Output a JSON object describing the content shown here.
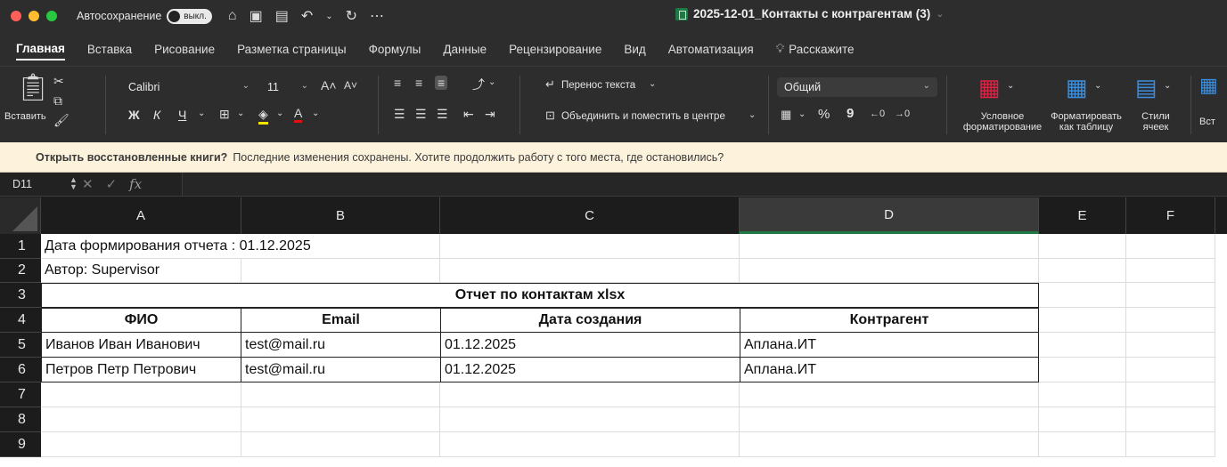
{
  "titlebar": {
    "autosave_label": "Автосохранение",
    "autosave_state": "выкл.",
    "document_title": "2025-12-01_Контакты с контрагентам (3)",
    "traffic_colors": [
      "#fe5f57",
      "#febc2e",
      "#28c840"
    ]
  },
  "tabs": [
    {
      "label": "Главная",
      "active": true
    },
    {
      "label": "Вставка"
    },
    {
      "label": "Рисование"
    },
    {
      "label": "Разметка страницы"
    },
    {
      "label": "Формулы"
    },
    {
      "label": "Данные"
    },
    {
      "label": "Рецензирование"
    },
    {
      "label": "Вид"
    },
    {
      "label": "Автоматизация"
    },
    {
      "label": "Расскажите"
    }
  ],
  "ribbon": {
    "paste_label": "Вставить",
    "font_name": "Calibri",
    "font_size": "11",
    "bold": "Ж",
    "italic": "К",
    "underline": "Ч",
    "wrap_text": "Перенос текста",
    "merge_center": "Объединить и поместить в центре",
    "number_format": "Общий",
    "percent": "%",
    "comma": "9",
    "conditional_format": "Условное форматирование",
    "format_table": "Форматировать как таблицу",
    "cell_styles": "Стили ячеек",
    "insert_cells": "Вст"
  },
  "notice": {
    "question": "Открыть восстановленные книги?",
    "message": "Последние изменения сохранены. Хотите продолжить работу с того места, где остановились?"
  },
  "formula_bar": {
    "name_box": "D11",
    "fx": "fx",
    "value": ""
  },
  "grid": {
    "columns": [
      "A",
      "B",
      "C",
      "D",
      "E",
      "F"
    ],
    "selected_column": "D",
    "rows": [
      "1",
      "2",
      "3",
      "4",
      "5",
      "6",
      "7",
      "8",
      "9"
    ],
    "cells": {
      "A1": "Дата формирования отчета : 01.12.2025",
      "A2": "Автор: Supervisor",
      "A3": "Отчет по контактам xlsx",
      "A4": "ФИО",
      "B4": "Email",
      "C4": "Дата создания",
      "D4": "Контрагент",
      "A5": "Иванов Иван Иванович",
      "B5": "test@mail.ru",
      "C5": "01.12.2025",
      "D5": "Аплана.ИТ",
      "A6": "Петров Петр Петрович",
      "B6": "test@mail.ru",
      "C6": "01.12.2025",
      "D6": "Аплана.ИТ"
    }
  }
}
